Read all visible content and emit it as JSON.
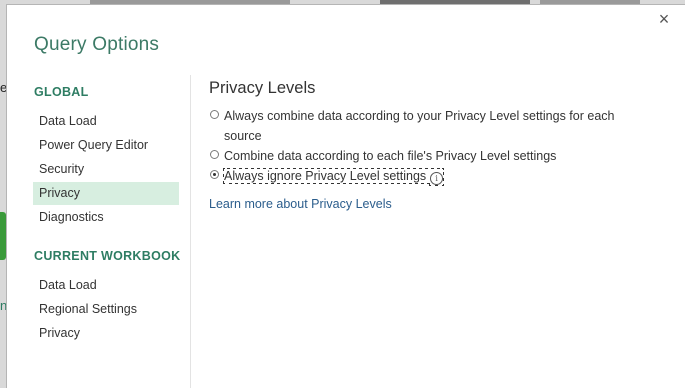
{
  "dialog": {
    "title": "Query Options",
    "close_glyph": "×"
  },
  "background": {
    "edge_letter_1": "e",
    "edge_letter_2": "n"
  },
  "sidebar": {
    "global_header": "GLOBAL",
    "global_items": [
      "Data Load",
      "Power Query Editor",
      "Security",
      "Privacy",
      "Diagnostics"
    ],
    "selected_item": "Privacy",
    "workbook_header": "CURRENT WORKBOOK",
    "workbook_items": [
      "Data Load",
      "Regional Settings",
      "Privacy"
    ]
  },
  "content": {
    "title": "Privacy Levels",
    "options": [
      {
        "label": "Always combine data according to your Privacy Level settings for each source",
        "checked": false
      },
      {
        "label": "Combine data according to each file's Privacy Level settings",
        "checked": false
      },
      {
        "label": "Always ignore Privacy Level settings",
        "checked": true
      }
    ],
    "info_icon": "info-icon",
    "info_glyph": "i",
    "learn_more": "Learn more about Privacy Levels"
  },
  "colors": {
    "title": "#3c7a66",
    "section_header": "#2e7d63",
    "selected_bg": "#d7eee0",
    "link": "#2b5d8c"
  }
}
